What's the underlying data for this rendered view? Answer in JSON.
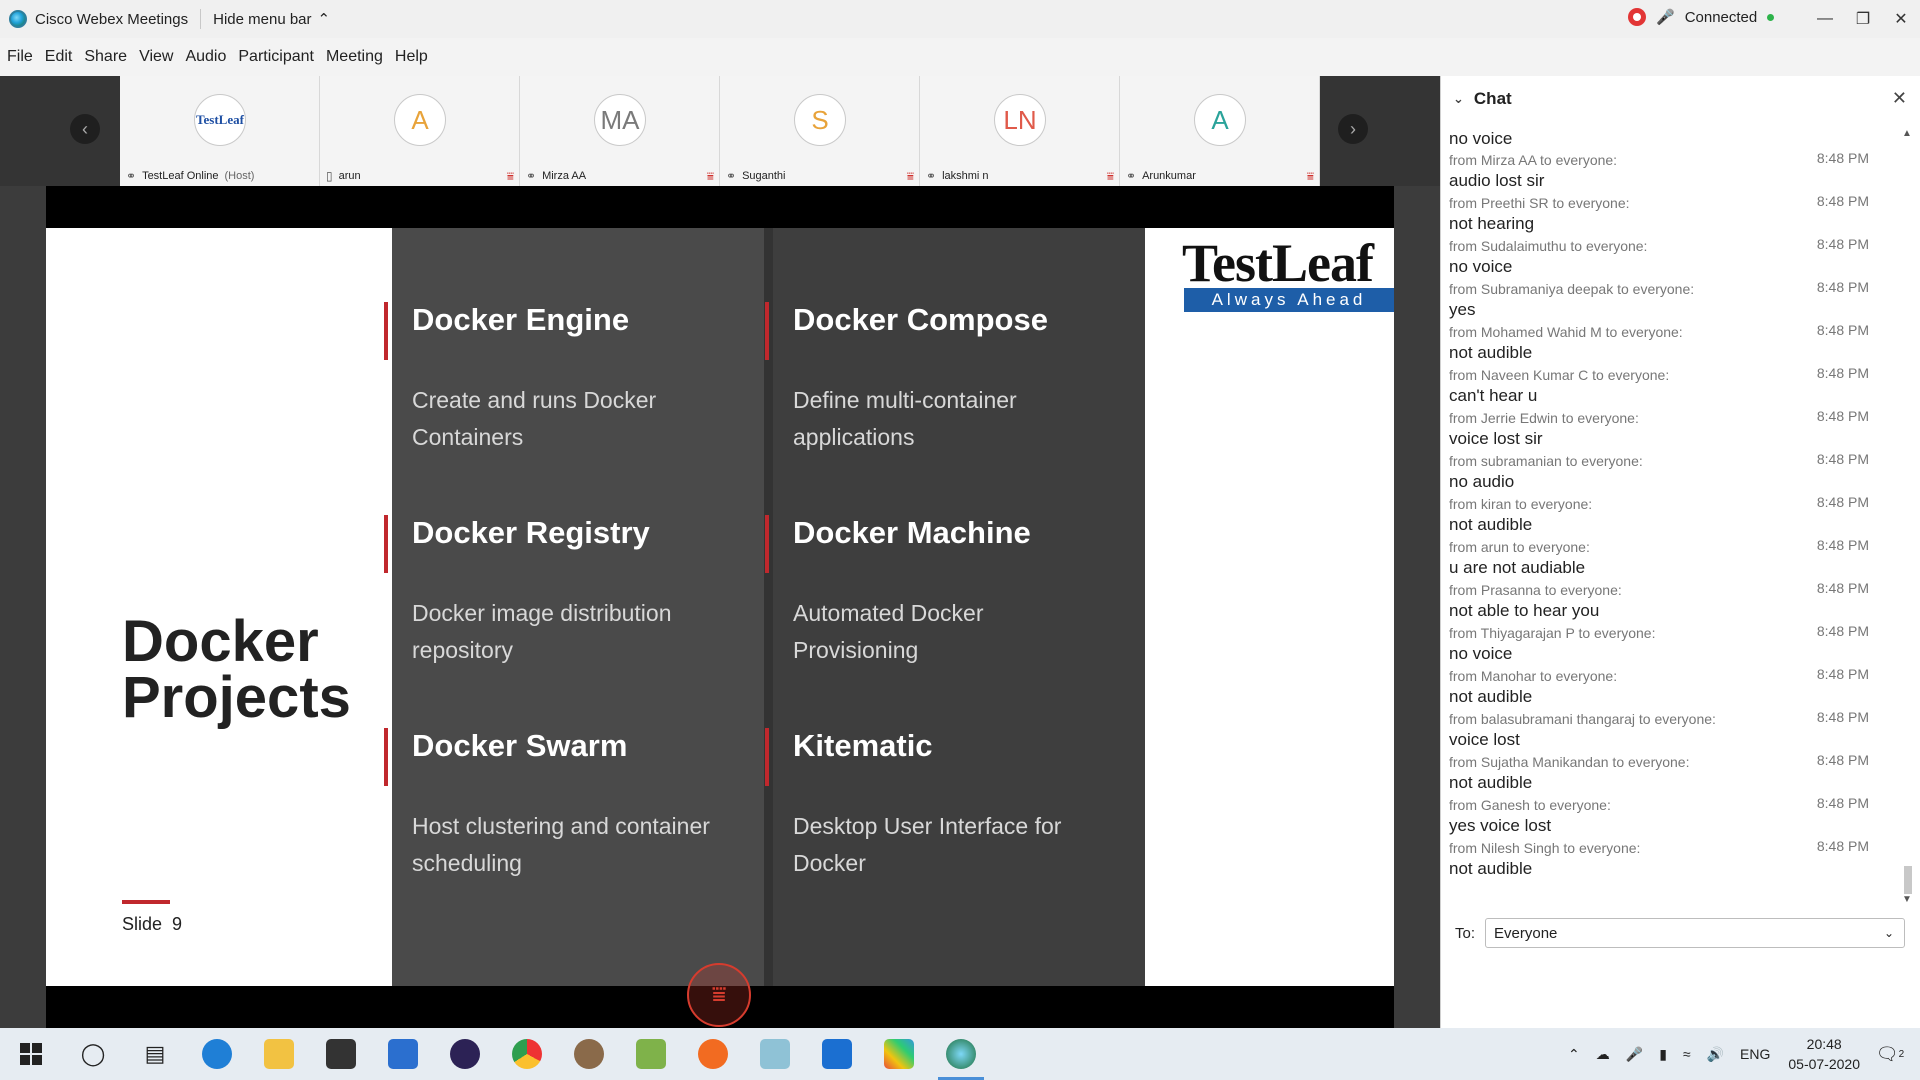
{
  "app": {
    "title": "Cisco Webex Meetings",
    "hide_menu": "Hide menu bar",
    "status": "Connected"
  },
  "menu": [
    "File",
    "Edit",
    "Share",
    "View",
    "Audio",
    "Participant",
    "Meeting",
    "Help"
  ],
  "participants": [
    {
      "initials": "TestLeaf",
      "name": "TestLeaf Online",
      "role": "(Host)",
      "color": "#1e4fa3"
    },
    {
      "initials": "A",
      "name": "arun",
      "role": "",
      "color": "#e8a33a"
    },
    {
      "initials": "MA",
      "name": "Mirza AA",
      "role": "",
      "color": "#7a7a7a"
    },
    {
      "initials": "S",
      "name": "Suganthi",
      "role": "",
      "color": "#e8a33a"
    },
    {
      "initials": "LN",
      "name": "lakshmi n",
      "role": "",
      "color": "#e05a4a"
    },
    {
      "initials": "A",
      "name": "Arunkumar",
      "role": "",
      "color": "#2aa39a"
    }
  ],
  "slide": {
    "title_line1": "Docker",
    "title_line2": "Projects",
    "slide_label": "Slide",
    "slide_number": "9",
    "logo_text": "TestLeaf",
    "logo_tagline": "Always Ahead",
    "features": [
      {
        "title": "Docker Engine",
        "desc": "Create and runs Docker Containers"
      },
      {
        "title": "Docker Compose",
        "desc": "Define multi-container applications"
      },
      {
        "title": "Docker Registry",
        "desc": "Docker image distribution repository"
      },
      {
        "title": "Docker Machine",
        "desc": "Automated Docker Provisioning"
      },
      {
        "title": "Docker Swarm",
        "desc": "Host clustering and container scheduling"
      },
      {
        "title": "Kitematic",
        "desc": "Desktop User Interface for Docker"
      }
    ]
  },
  "chat": {
    "title": "Chat",
    "first_text": "no voice",
    "messages": [
      {
        "from": "from Mirza AA to everyone:",
        "time": "8:48 PM",
        "text": "audio lost sir"
      },
      {
        "from": "from Preethi SR to everyone:",
        "time": "8:48 PM",
        "text": "not hearing"
      },
      {
        "from": "from Sudalaimuthu to everyone:",
        "time": "8:48 PM",
        "text": "no voice"
      },
      {
        "from": "from Subramaniya deepak to everyone:",
        "time": "8:48 PM",
        "text": "yes"
      },
      {
        "from": "from Mohamed Wahid M to everyone:",
        "time": "8:48 PM",
        "text": "not audible"
      },
      {
        "from": "from Naveen Kumar C to everyone:",
        "time": "8:48 PM",
        "text": "can't hear u"
      },
      {
        "from": "from Jerrie Edwin to everyone:",
        "time": "8:48 PM",
        "text": "voice lost sir"
      },
      {
        "from": "from subramanian to everyone:",
        "time": "8:48 PM",
        "text": "no audio"
      },
      {
        "from": "from kiran to everyone:",
        "time": "8:48 PM",
        "text": "not audible"
      },
      {
        "from": "from arun to everyone:",
        "time": "8:48 PM",
        "text": "u are not audiable"
      },
      {
        "from": "from Prasanna to everyone:",
        "time": "8:48 PM",
        "text": "not able to hear you"
      },
      {
        "from": "from Thiyagarajan P to everyone:",
        "time": "8:48 PM",
        "text": "no voice"
      },
      {
        "from": "from Manohar to everyone:",
        "time": "8:48 PM",
        "text": "not audible"
      },
      {
        "from": "from balasubramani thangaraj to everyone:",
        "time": "8:48 PM",
        "text": "voice lost"
      },
      {
        "from": "from Sujatha Manikandan to everyone:",
        "time": "8:48 PM",
        "text": "not audible"
      },
      {
        "from": "from Ganesh to everyone:",
        "time": "8:48 PM",
        "text": "yes voice lost"
      },
      {
        "from": "from Nilesh Singh to everyone:",
        "time": "8:48 PM",
        "text": "not audible"
      }
    ],
    "to_label": "To:",
    "to_value": "Everyone"
  },
  "taskbar": {
    "language": "ENG",
    "time": "20:48",
    "date": "05-07-2020",
    "notifications": "2"
  }
}
